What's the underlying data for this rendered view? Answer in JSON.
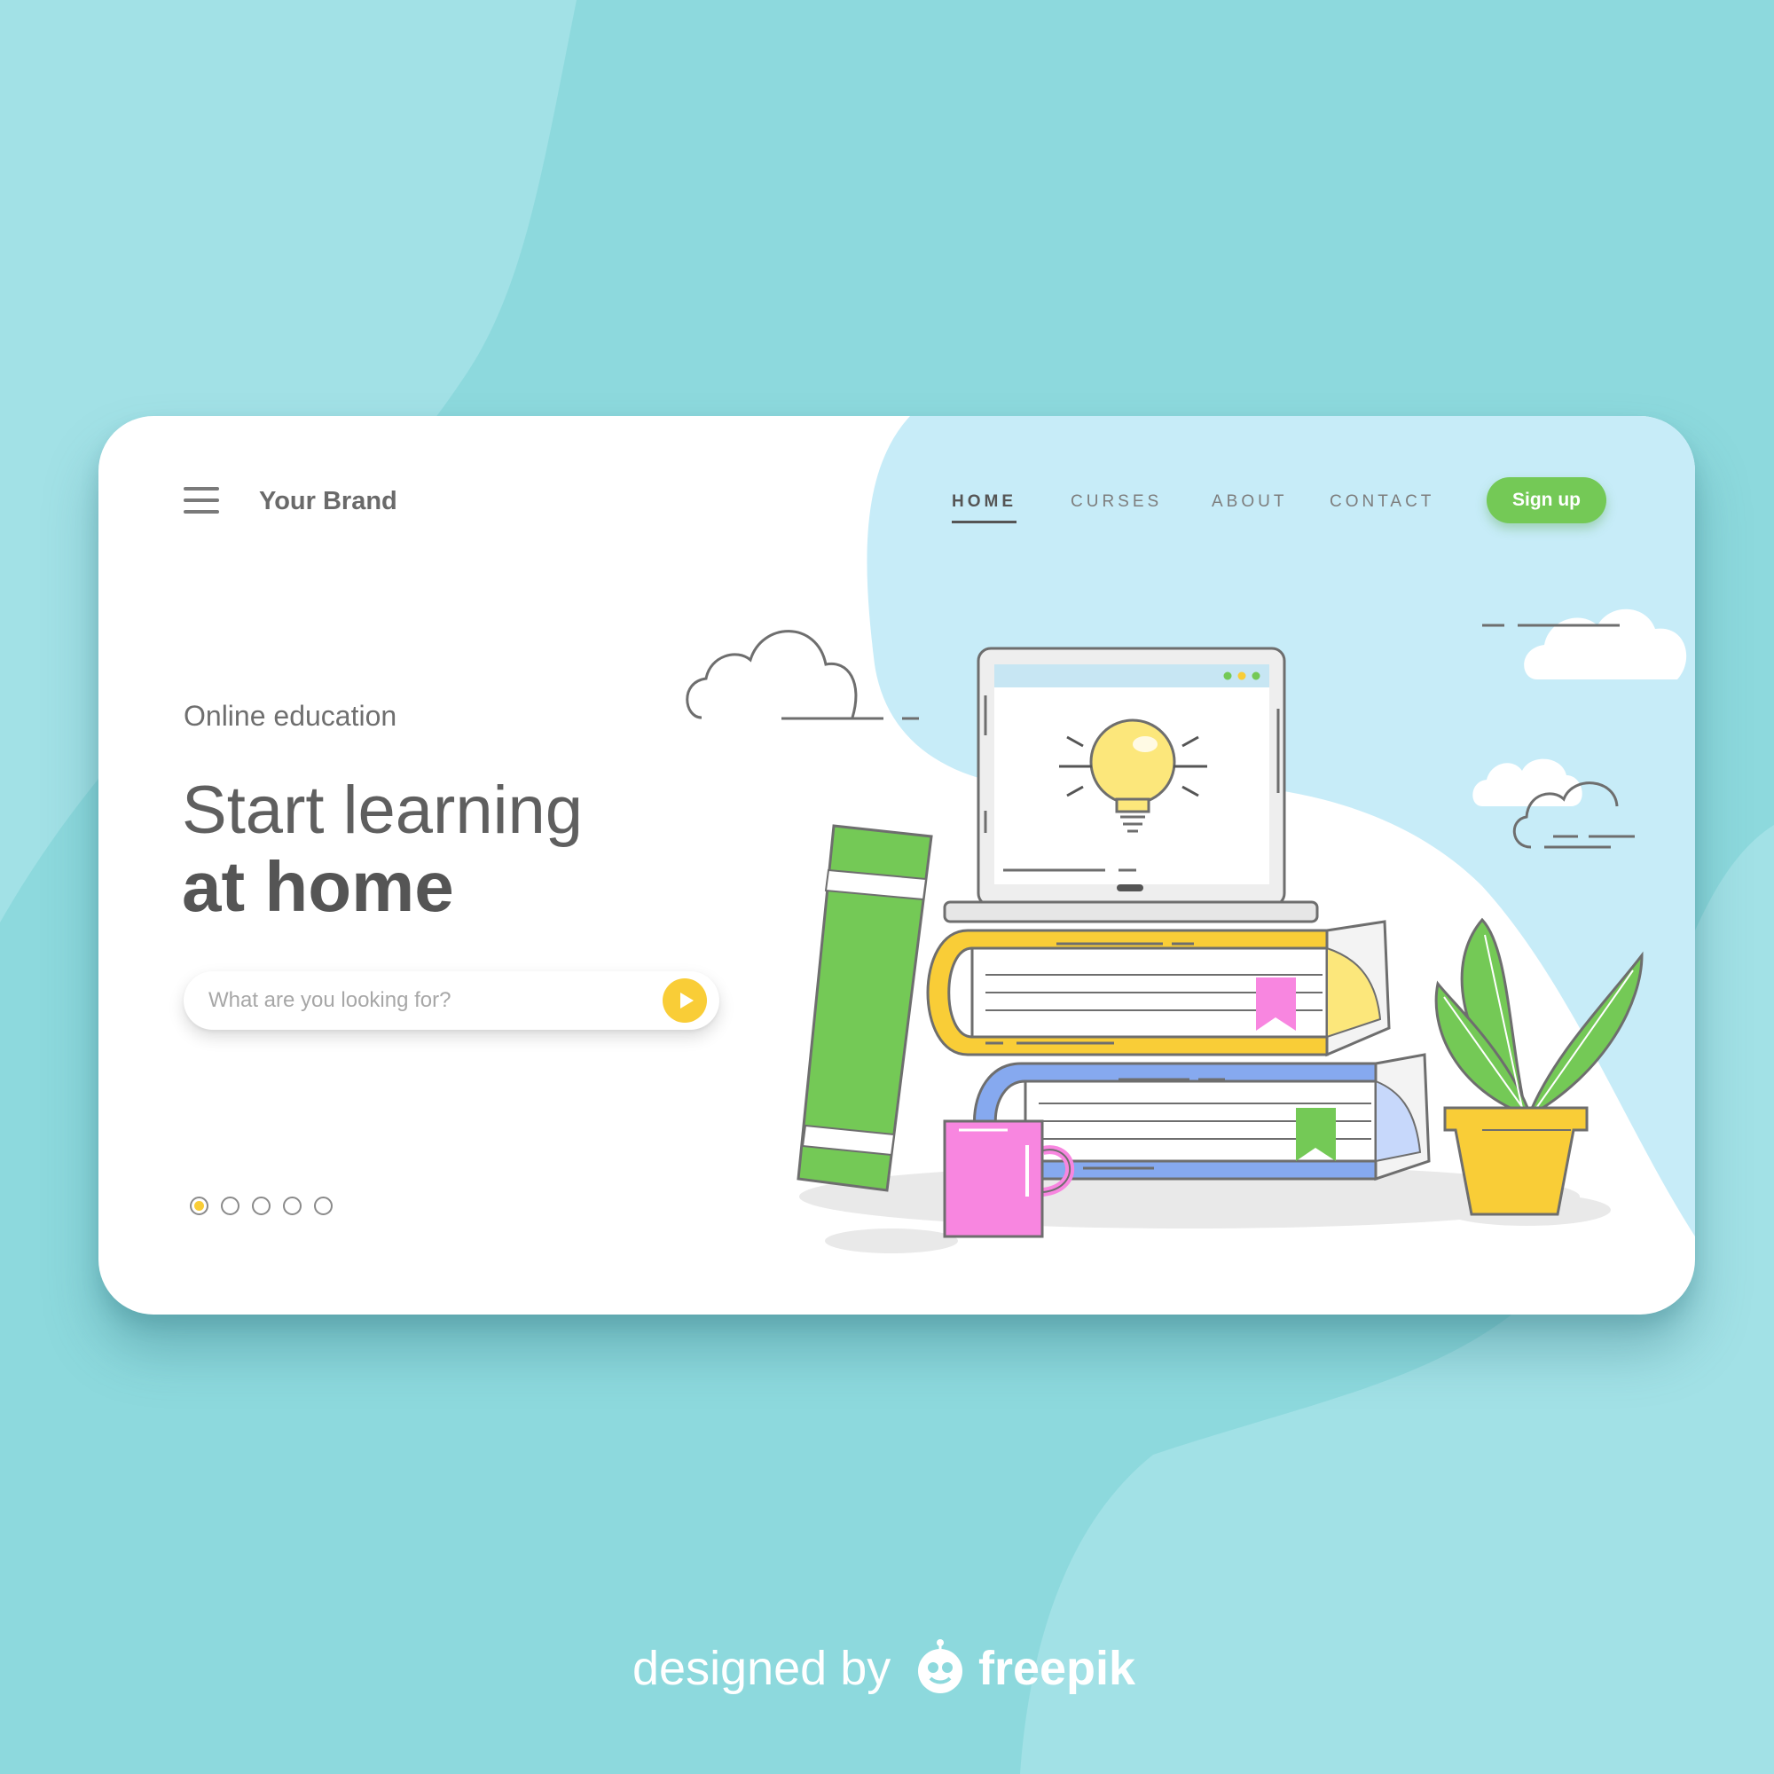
{
  "header": {
    "brand": "Your Brand",
    "nav": [
      {
        "label": "HOME",
        "active": true
      },
      {
        "label": "CURSES",
        "active": false
      },
      {
        "label": "ABOUT",
        "active": false
      },
      {
        "label": "CONTACT",
        "active": false
      }
    ],
    "signup_label": "Sign up"
  },
  "hero": {
    "eyebrow": "Online education",
    "title_line1": "Start learning",
    "title_line2": "at home"
  },
  "search": {
    "placeholder": "What are you looking for?",
    "value": ""
  },
  "pager": {
    "count": 5,
    "active_index": 0
  },
  "credit": {
    "prefix": "designed by",
    "brand": "freepik"
  },
  "icons": {
    "menu": "hamburger-menu-icon",
    "search_submit": "play-arrow-icon",
    "credit_logo": "freepik-logo-icon"
  },
  "colors": {
    "page_background": "#8dd9dd",
    "card": "#ffffff",
    "sky": "#c7ecf8",
    "accent_green": "#74c956",
    "accent_yellow": "#f9cd37",
    "text_dark": "#555555",
    "text_muted": "#7d7d7d"
  }
}
